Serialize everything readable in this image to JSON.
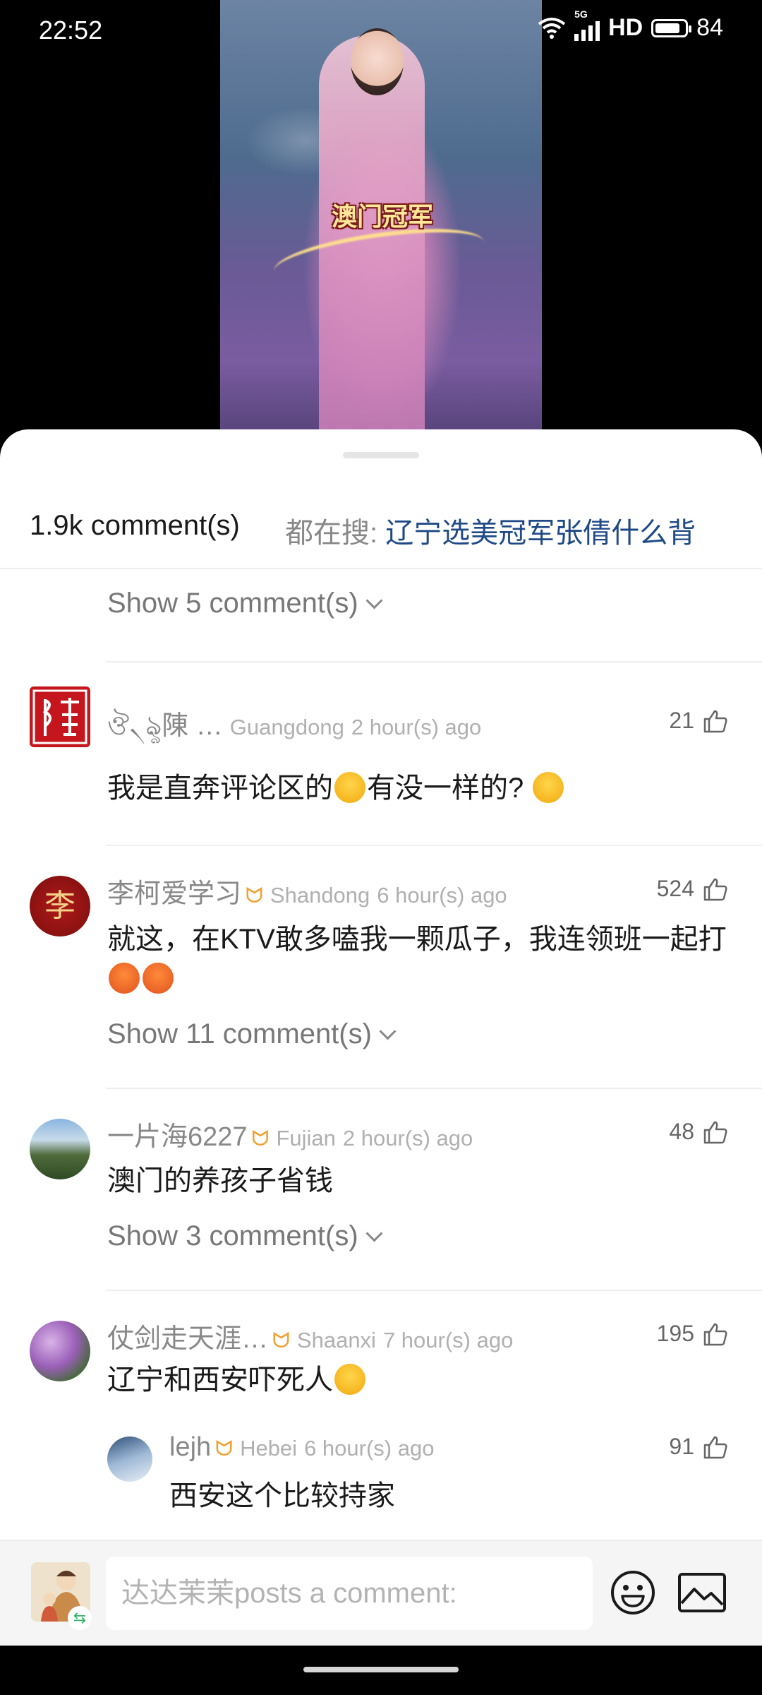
{
  "status": {
    "time": "22:52",
    "network": "5G",
    "hd_label": "HD",
    "battery": "84",
    "battery_level": 0.84
  },
  "video": {
    "caption": "澳门冠军"
  },
  "sheet": {
    "comment_count": "1.9k comment(s)",
    "trending_label": "都在搜:",
    "trending_query": "辽宁选美冠军张倩什么背"
  },
  "comments": [
    {
      "show_more": "Show 5 comment(s)"
    },
    {
      "user": "ঔ৲ৡ陳 …",
      "location": "Guangdong",
      "time": "2 hour(s) ago",
      "likes": "21",
      "text_a": "我是直奔评论区的",
      "text_b": "有没一样的?"
    },
    {
      "user": "李柯爱学习",
      "location": "Shandong",
      "time": "6 hour(s) ago",
      "likes": "524",
      "text": "就这，在KTV敢多嗑我一颗瓜子，我连领班一起打",
      "show_more": "Show 11 comment(s)",
      "avatar_char": "李"
    },
    {
      "user": "一片海6227",
      "location": "Fujian",
      "time": "2 hour(s) ago",
      "likes": "48",
      "text": "澳门的养孩子省钱",
      "show_more": "Show 3 comment(s)"
    },
    {
      "user": "仗剑走天涯…",
      "location": "Shaanxi",
      "time": "7 hour(s) ago",
      "likes": "195",
      "text": "辽宁和西安吓死人",
      "reply": {
        "user": "lejh",
        "location": "Hebei",
        "time": "6 hour(s) ago",
        "likes": "91",
        "text": "西安这个比较持家"
      }
    }
  ],
  "composer": {
    "placeholder": "达达茉茉posts a comment:",
    "emoji_icon": "smiley-icon",
    "image_icon": "image-icon"
  }
}
